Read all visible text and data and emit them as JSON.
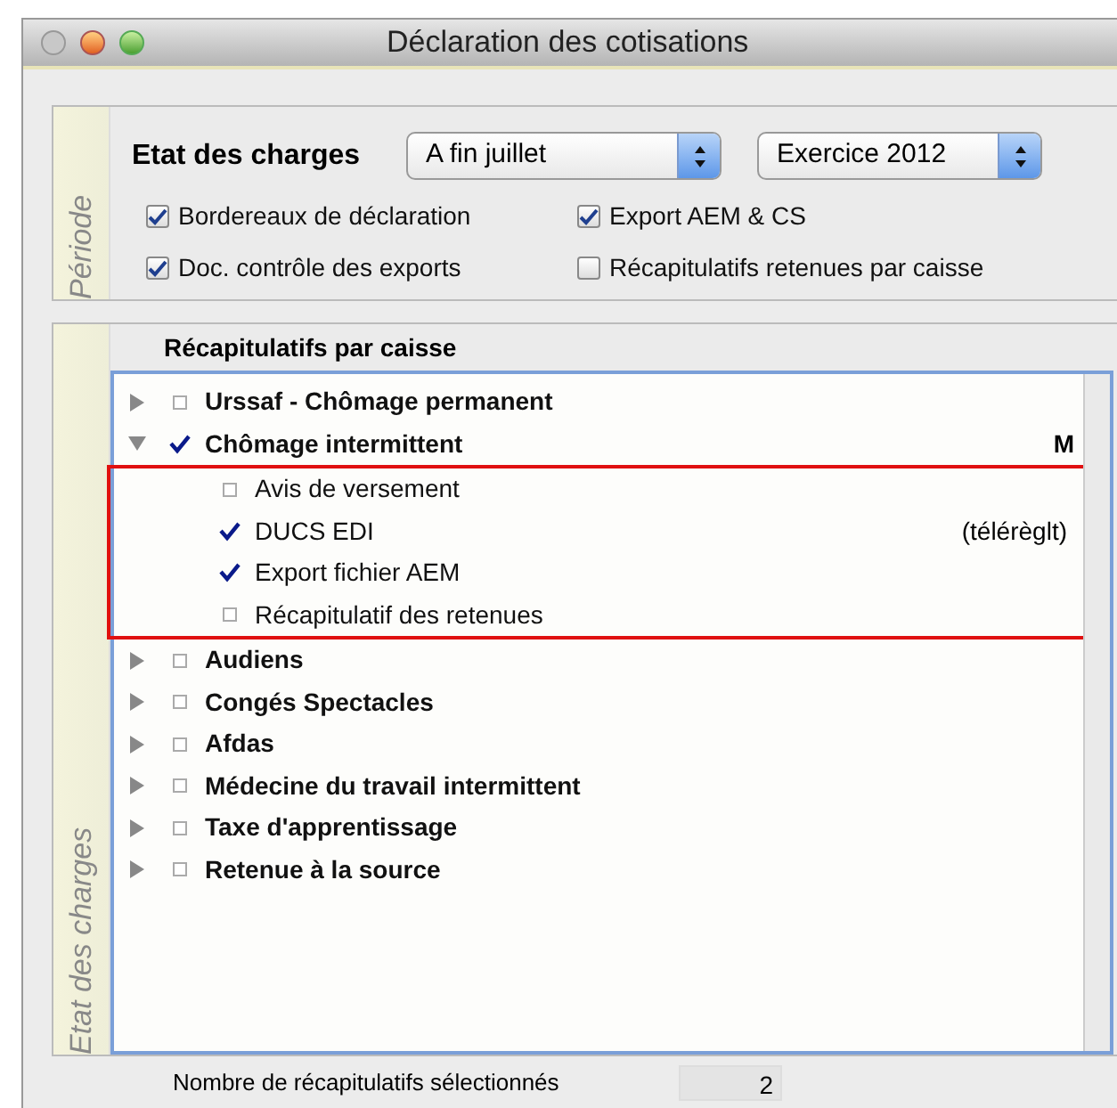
{
  "window": {
    "title": "Déclaration des cotisations"
  },
  "periode": {
    "label": "Période",
    "heading": "Etat des charges",
    "month_select": "A fin juillet",
    "year_select": "Exercice 2012",
    "options": [
      {
        "label": "Bordereaux de déclaration",
        "checked": true
      },
      {
        "label": "Export AEM & CS",
        "checked": true
      },
      {
        "label": "Doc. contrôle des exports",
        "checked": true
      },
      {
        "label": "Récapitulatifs retenues par caisse",
        "checked": false
      }
    ]
  },
  "etat": {
    "label": "Etat des charges",
    "column_heading": "Récapitulatifs par caisse",
    "tree": [
      {
        "label": "Urssaf - Chômage permanent",
        "checked": false,
        "expanded": false
      },
      {
        "label": "Chômage intermittent",
        "checked": true,
        "expanded": true,
        "note": "M",
        "children_highlighted": true,
        "children": [
          {
            "label": "Avis de versement",
            "checked": false
          },
          {
            "label": "DUCS EDI",
            "checked": true,
            "note": "(télérèglt)"
          },
          {
            "label": "Export fichier AEM",
            "checked": true
          },
          {
            "label": "Récapitulatif des retenues",
            "checked": false
          }
        ]
      },
      {
        "label": "Audiens",
        "checked": false,
        "expanded": false
      },
      {
        "label": "Congés Spectacles",
        "checked": false,
        "expanded": false
      },
      {
        "label": "Afdas",
        "checked": false,
        "expanded": false
      },
      {
        "label": "Médecine du travail intermittent",
        "checked": false,
        "expanded": false
      },
      {
        "label": "Taxe d'apprentissage",
        "checked": false,
        "expanded": false
      },
      {
        "label": "Retenue à la source",
        "checked": false,
        "expanded": false
      }
    ]
  },
  "footer": {
    "label": "Nombre de récapitulatifs sélectionnés",
    "value": "2"
  }
}
